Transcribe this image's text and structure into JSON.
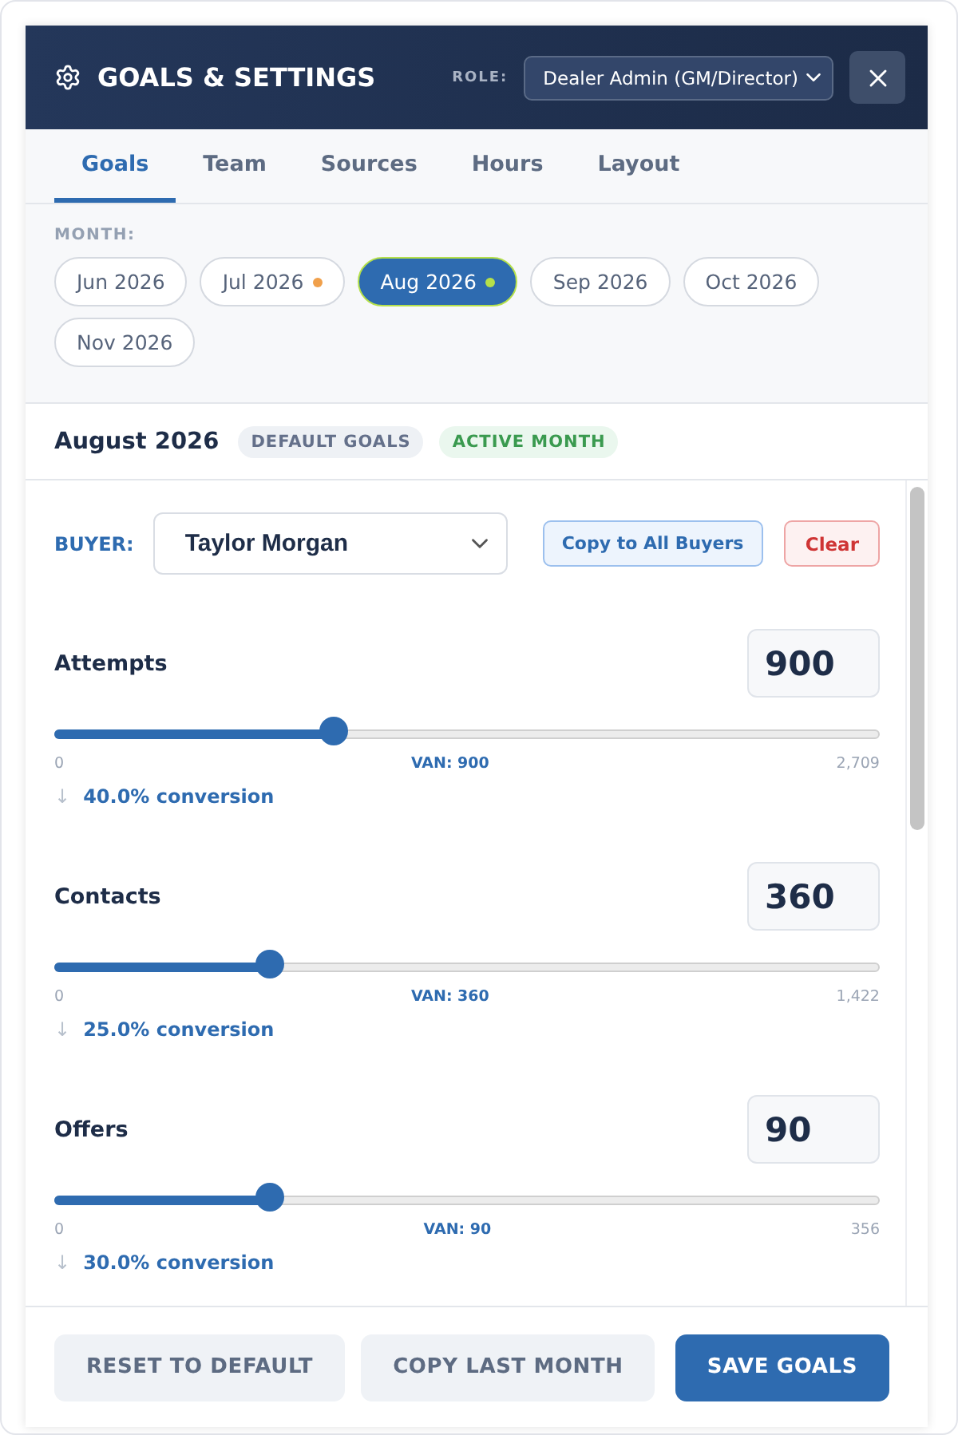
{
  "header": {
    "title": "GOALS & SETTINGS",
    "role_label": "ROLE:",
    "role_value": "Dealer Admin (GM/Director)"
  },
  "tabs": [
    {
      "label": "Goals",
      "selected": true
    },
    {
      "label": "Team",
      "selected": false
    },
    {
      "label": "Sources",
      "selected": false
    },
    {
      "label": "Hours",
      "selected": false
    },
    {
      "label": "Layout",
      "selected": false
    }
  ],
  "month": {
    "label": "MONTH:",
    "options": [
      {
        "label": "Jun 2026",
        "selected": false
      },
      {
        "label": "Jul 2026",
        "selected": false,
        "color": "#f0a04b"
      },
      {
        "label": "Aug 2026",
        "selected": true,
        "color": "#b5e04a"
      },
      {
        "label": "Sep 2026",
        "selected": false
      },
      {
        "label": "Oct 2026",
        "selected": false
      },
      {
        "label": "Nov 2026",
        "selected": false
      }
    ]
  },
  "period": {
    "title": "August 2026",
    "badges": [
      {
        "label": "DEFAULT GOALS",
        "kind": "neutral"
      },
      {
        "label": "ACTIVE MONTH",
        "kind": "success"
      }
    ]
  },
  "buyer": {
    "label": "BUYER:",
    "value": "Taylor Morgan",
    "copy_button": "Copy to All Buyers",
    "clear_button": "Clear"
  },
  "goals": [
    {
      "name": "Attempts",
      "value": "900",
      "level": 0.337,
      "min": "0",
      "reading": "VAN: 900",
      "max": "2,709",
      "arrow": "↓",
      "conversion": "40.0% conversion"
    },
    {
      "name": "Contacts",
      "value": "360",
      "level": 0.261,
      "min": "0",
      "reading": "VAN: 360",
      "max": "1,422",
      "arrow": "↓",
      "conversion": "25.0% conversion"
    },
    {
      "name": "Offers",
      "value": "90",
      "level": 0.261,
      "min": "0",
      "reading": "VAN: 90",
      "max": "356",
      "arrow": "↓",
      "conversion": "30.0% conversion"
    }
  ],
  "footer": {
    "buttons": [
      {
        "label": "RESET TO DEFAULT",
        "kind": "secondary"
      },
      {
        "label": "COPY LAST MONTH",
        "kind": "secondary"
      },
      {
        "label": "SAVE GOALS",
        "kind": "primary"
      }
    ]
  }
}
